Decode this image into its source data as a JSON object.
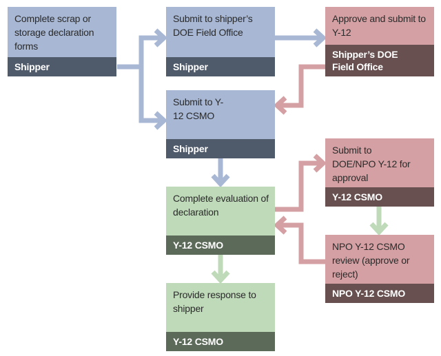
{
  "colors": {
    "shipper": "#a7b7d4",
    "field_office": "#d4a0a3",
    "csmo": "#bfdab9"
  },
  "steps": [
    {
      "text": "Complete scrap or storage declaration forms",
      "actor": "Shipper"
    },
    {
      "text": "Submit to shipper’s DOE Field Office",
      "actor": "Shipper"
    },
    {
      "text": "Approve and submit to Y-12",
      "actor": "Shipper’s DOE Field Office"
    },
    {
      "text": "Submit to Y-12 CSMO",
      "actor": "Shipper"
    },
    {
      "text": "Submit to DOE/NPO Y-12 for approval",
      "actor": "Y-12 CSMO"
    },
    {
      "text": "Complete evaluation of declaration",
      "actor": "Y-12 CSMO"
    },
    {
      "text": "NPO Y-12 CSMO review (approve or reject)",
      "actor": "NPO Y-12 CSMO"
    },
    {
      "text": "Provide response to shipper",
      "actor": "Y-12 CSMO"
    }
  ]
}
